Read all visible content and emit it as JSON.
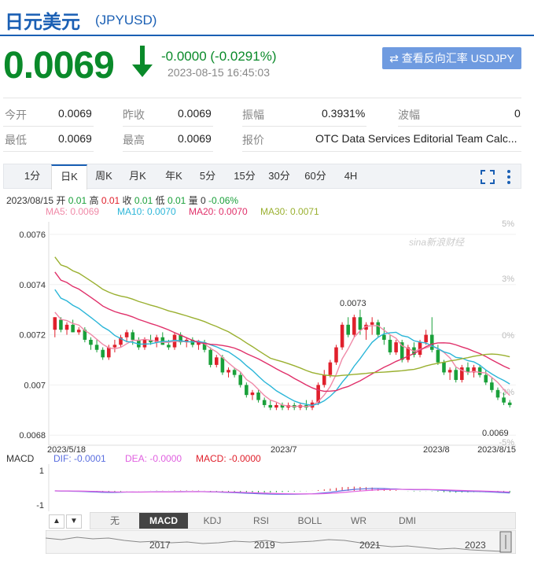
{
  "header": {
    "name": "日元美元",
    "code": "(JPYUSD)",
    "price": "0.0069",
    "change": "-0.0000 (-0.0291%)",
    "datetime": "2023-08-15 16:45:03",
    "reverse_button": "查看反向汇率 USDJPY"
  },
  "quote_table": {
    "row1": [
      {
        "label": "今开",
        "value": "0.0069"
      },
      {
        "label": "昨收",
        "value": "0.0069"
      },
      {
        "label": "振幅",
        "value": "0.3931%"
      },
      {
        "label": "波幅",
        "value": "0"
      }
    ],
    "row2": [
      {
        "label": "最低",
        "value": "0.0069"
      },
      {
        "label": "最高",
        "value": "0.0069"
      },
      {
        "label": "报价",
        "value": "OTC Data Services Editorial Team Calc..."
      }
    ]
  },
  "period_tabs": [
    "1分",
    "日K",
    "周K",
    "月K",
    "年K",
    "5分",
    "15分",
    "30分",
    "60分",
    "4H"
  ],
  "active_period": "日K",
  "ohlc_info": {
    "date": "2023/08/15",
    "open_label": "开",
    "open": "0.01",
    "high_label": "高",
    "high": "0.01",
    "close_label": "收",
    "close": "0.01",
    "low_label": "低",
    "low": "0.01",
    "vol_label": "量",
    "vol": "0",
    "pct": "-0.06%"
  },
  "ma_legend": {
    "ma5": "MA5: 0.0069",
    "ma10": "MA10: 0.0070",
    "ma20": "MA20: 0.0070",
    "ma30": "MA30: 0.0071"
  },
  "watermark": "sina新浪财经",
  "macd_legend": {
    "macd": "MACD",
    "dif": "DIF: -0.0001",
    "dea": "DEA: -0.0000",
    "val": "MACD: -0.0000"
  },
  "indicator_tabs": [
    "无",
    "MACD",
    "KDJ",
    "RSI",
    "BOLL",
    "WR",
    "DMI"
  ],
  "active_indicator": "MACD",
  "nav": {
    "up": "▲",
    "down": "▼"
  },
  "overview_years": [
    "2017",
    "2019",
    "2021",
    "2023"
  ],
  "colors": {
    "up": "#e0202c",
    "down": "#1aa03a",
    "ma5": "#f08aa8",
    "ma10": "#2bb6d8",
    "ma20": "#e0306a",
    "ma30": "#9ab030",
    "accent": "#1a5fb4",
    "dif": "#5b6fe0",
    "dea": "#e060e0"
  },
  "chart_data": {
    "type": "candlestick",
    "y_left_ticks": [
      "0.0076",
      "0.0074",
      "0.0072",
      "0.007",
      "0.0068"
    ],
    "y_right_ticks": [
      "5%",
      "3%",
      "0%",
      "-3%",
      "-5%"
    ],
    "ylim": [
      0.00676,
      0.00765
    ],
    "x_labels": [
      "2023/5/18",
      "2023/7",
      "2023/8",
      "2023/8/15"
    ],
    "annotations": [
      {
        "text": "0.0073"
      },
      {
        "text": "0.0069"
      }
    ],
    "macd_ticks": [
      "1",
      "-1"
    ],
    "candles": [
      [
        0.00722,
        0.00727,
        0.00719,
        0.00727
      ],
      [
        0.00726,
        0.00727,
        0.00721,
        0.00722
      ],
      [
        0.00722,
        0.00725,
        0.0072,
        0.00724
      ],
      [
        0.00724,
        0.00726,
        0.00721,
        0.00721
      ],
      [
        0.00721,
        0.00723,
        0.0072,
        0.00722
      ],
      [
        0.00722,
        0.00723,
        0.00717,
        0.00718
      ],
      [
        0.00718,
        0.00719,
        0.00714,
        0.00716
      ],
      [
        0.00716,
        0.00718,
        0.00713,
        0.00714
      ],
      [
        0.00714,
        0.00715,
        0.0071,
        0.00711
      ],
      [
        0.00711,
        0.00716,
        0.0071,
        0.00715
      ],
      [
        0.00715,
        0.00718,
        0.00713,
        0.00716
      ],
      [
        0.00716,
        0.0072,
        0.00715,
        0.00719
      ],
      [
        0.00719,
        0.00722,
        0.00717,
        0.00721
      ],
      [
        0.00721,
        0.00722,
        0.00716,
        0.00718
      ],
      [
        0.00718,
        0.00719,
        0.00714,
        0.00715
      ],
      [
        0.00715,
        0.00719,
        0.00714,
        0.00718
      ],
      [
        0.00718,
        0.0072,
        0.00716,
        0.00717
      ],
      [
        0.00717,
        0.0072,
        0.00715,
        0.00719
      ],
      [
        0.00719,
        0.00721,
        0.00716,
        0.00716
      ],
      [
        0.00716,
        0.00718,
        0.00714,
        0.00715
      ],
      [
        0.00715,
        0.00721,
        0.00714,
        0.0072
      ],
      [
        0.0072,
        0.00721,
        0.00716,
        0.00717
      ],
      [
        0.00717,
        0.00719,
        0.00715,
        0.00718
      ],
      [
        0.00718,
        0.00719,
        0.00715,
        0.00716
      ],
      [
        0.00716,
        0.00718,
        0.00714,
        0.00717
      ],
      [
        0.00717,
        0.00718,
        0.00713,
        0.00714
      ],
      [
        0.00714,
        0.00715,
        0.00707,
        0.00708
      ],
      [
        0.00708,
        0.00712,
        0.00707,
        0.00711
      ],
      [
        0.00711,
        0.00712,
        0.00704,
        0.00705
      ],
      [
        0.00705,
        0.00707,
        0.00703,
        0.00706
      ],
      [
        0.00706,
        0.00707,
        0.00703,
        0.00704
      ],
      [
        0.00704,
        0.00705,
        0.00699,
        0.007
      ],
      [
        0.007,
        0.00701,
        0.00695,
        0.00696
      ],
      [
        0.00696,
        0.00698,
        0.00694,
        0.00697
      ],
      [
        0.00697,
        0.00698,
        0.00693,
        0.00694
      ],
      [
        0.00694,
        0.00695,
        0.00691,
        0.00692
      ],
      [
        0.00692,
        0.00694,
        0.0069,
        0.00691
      ],
      [
        0.00691,
        0.00693,
        0.0069,
        0.00692
      ],
      [
        0.00692,
        0.00693,
        0.0069,
        0.00691
      ],
      [
        0.00691,
        0.00693,
        0.0069,
        0.00692
      ],
      [
        0.00692,
        0.00693,
        0.0069,
        0.00691
      ],
      [
        0.00691,
        0.00693,
        0.0069,
        0.00692
      ],
      [
        0.00692,
        0.00694,
        0.0069,
        0.00691
      ],
      [
        0.00691,
        0.00694,
        0.0069,
        0.00693
      ],
      [
        0.00693,
        0.00701,
        0.00692,
        0.007
      ],
      [
        0.007,
        0.00706,
        0.00699,
        0.00704
      ],
      [
        0.00704,
        0.0071,
        0.00703,
        0.00709
      ],
      [
        0.00709,
        0.00716,
        0.00708,
        0.00715
      ],
      [
        0.00715,
        0.00725,
        0.00714,
        0.00724
      ],
      [
        0.00724,
        0.00727,
        0.00719,
        0.0072
      ],
      [
        0.0072,
        0.00728,
        0.00719,
        0.00727
      ],
      [
        0.00727,
        0.0073,
        0.0072,
        0.00722
      ],
      [
        0.00722,
        0.00725,
        0.00718,
        0.00724
      ],
      [
        0.00724,
        0.00727,
        0.0072,
        0.00725
      ],
      [
        0.00725,
        0.00726,
        0.00719,
        0.0072
      ],
      [
        0.0072,
        0.00723,
        0.00716,
        0.00718
      ],
      [
        0.00718,
        0.0072,
        0.00712,
        0.00713
      ],
      [
        0.00713,
        0.00718,
        0.00712,
        0.00717
      ],
      [
        0.00717,
        0.00718,
        0.00709,
        0.0071
      ],
      [
        0.0071,
        0.00716,
        0.00709,
        0.00715
      ],
      [
        0.00715,
        0.00717,
        0.00711,
        0.00712
      ],
      [
        0.00712,
        0.00718,
        0.00711,
        0.00717
      ],
      [
        0.00717,
        0.00722,
        0.00716,
        0.0072
      ],
      [
        0.0072,
        0.00727,
        0.00713,
        0.00714
      ],
      [
        0.00714,
        0.00716,
        0.00708,
        0.00709
      ],
      [
        0.00709,
        0.0071,
        0.00704,
        0.00705
      ],
      [
        0.00705,
        0.00707,
        0.00702,
        0.00706
      ],
      [
        0.00706,
        0.00707,
        0.00701,
        0.00702
      ],
      [
        0.00702,
        0.00708,
        0.00701,
        0.00707
      ],
      [
        0.00707,
        0.00709,
        0.00704,
        0.00705
      ],
      [
        0.00705,
        0.00708,
        0.00703,
        0.00707
      ],
      [
        0.00707,
        0.00708,
        0.00703,
        0.00704
      ],
      [
        0.00704,
        0.00706,
        0.007,
        0.00701
      ],
      [
        0.00701,
        0.00703,
        0.00697,
        0.00698
      ],
      [
        0.00698,
        0.00699,
        0.00694,
        0.00695
      ],
      [
        0.00695,
        0.00697,
        0.00692,
        0.00693
      ],
      [
        0.00693,
        0.00694,
        0.00691,
        0.00692
      ]
    ]
  }
}
